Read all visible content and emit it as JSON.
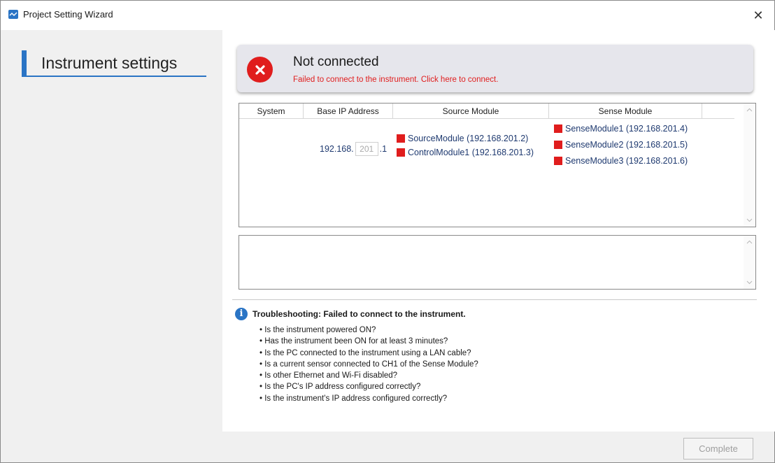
{
  "window": {
    "title": "Project Setting Wizard",
    "close_glyph": "✕"
  },
  "sidebar": {
    "items": [
      {
        "label": "Instrument settings",
        "selected": true
      }
    ]
  },
  "banner": {
    "status": "Not connected",
    "message": "Failed to connect to the instrument. Click here to connect.",
    "icon": "error-x-icon",
    "status_color": "#e01d1d"
  },
  "table": {
    "columns": [
      "System",
      "Base IP Address",
      "Source Module",
      "Sense Module"
    ],
    "rows": [
      {
        "system": "",
        "ip_prefix": "192.168.",
        "ip_third_octet": "201",
        "ip_suffix": ".1",
        "source_modules": [
          {
            "label": "SourceModule (192.168.201.2)",
            "status_color": "#e01d1d"
          },
          {
            "label": "ControlModule1 (192.168.201.3)",
            "status_color": "#e01d1d"
          }
        ],
        "sense_modules": [
          {
            "label": "SenseModule1 (192.168.201.4)",
            "status_color": "#e01d1d"
          },
          {
            "label": "SenseModule2 (192.168.201.5)",
            "status_color": "#e01d1d"
          },
          {
            "label": "SenseModule3 (192.168.201.6)",
            "status_color": "#e01d1d"
          }
        ]
      }
    ]
  },
  "troubleshooting": {
    "icon": "info-icon",
    "title": "Troubleshooting: Failed to connect to the instrument.",
    "items": [
      "Is the instrument powered ON?",
      "Has the instrument been ON for at least 3 minutes?",
      "Is the PC connected to the instrument using a LAN cable?",
      "Is a current sensor connected to CH1 of the Sense Module?",
      "Is other Ethernet and Wi-Fi disabled?",
      "Is the PC's IP address configured correctly?",
      "Is the instrument's IP address configured correctly?"
    ]
  },
  "footer": {
    "complete_label": "Complete",
    "complete_enabled": false
  }
}
